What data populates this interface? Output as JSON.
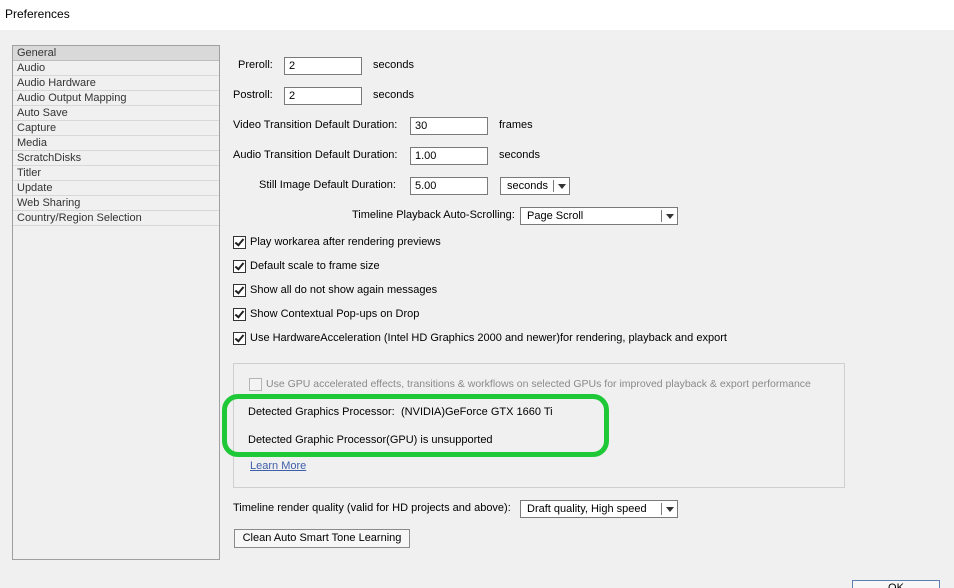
{
  "window": {
    "title": "Preferences"
  },
  "sidebar": {
    "items": [
      {
        "label": "General",
        "selected": true
      },
      {
        "label": "Audio"
      },
      {
        "label": "Audio Hardware"
      },
      {
        "label": "Audio Output Mapping"
      },
      {
        "label": "Auto Save"
      },
      {
        "label": "Capture"
      },
      {
        "label": "Media"
      },
      {
        "label": "ScratchDisks"
      },
      {
        "label": "Titler"
      },
      {
        "label": "Update"
      },
      {
        "label": "Web Sharing"
      },
      {
        "label": "Country/Region Selection"
      }
    ]
  },
  "general": {
    "preroll": {
      "label": "Preroll:",
      "value": "2",
      "unit": "seconds"
    },
    "postroll": {
      "label": "Postroll:",
      "value": "2",
      "unit": "seconds"
    },
    "video_transition": {
      "label": "Video Transition Default Duration:",
      "value": "30",
      "unit": "frames"
    },
    "audio_transition": {
      "label": "Audio Transition Default Duration:",
      "value": "1.00",
      "unit": "seconds"
    },
    "still_image": {
      "label": "Still Image Default Duration:",
      "value": "5.00",
      "unit": "seconds"
    },
    "timeline_scrolling": {
      "label": "Timeline Playback Auto-Scrolling:",
      "value": "Page Scroll"
    },
    "checkboxes": [
      {
        "label": "Play workarea after rendering previews",
        "checked": true
      },
      {
        "label": "Default scale to frame size",
        "checked": true
      },
      {
        "label": "Show all do not show again messages",
        "checked": true
      },
      {
        "label": "Show Contextual Pop-ups on Drop",
        "checked": true
      },
      {
        "label": "Use HardwareAcceleration (Intel HD Graphics 2000 and newer)for rendering, playback and export",
        "checked": true
      }
    ],
    "gpu": {
      "checkbox_label": "Use GPU accelerated effects, transitions & workflows on selected GPUs for improved playback & export performance",
      "checked": false,
      "detected_label": "Detected Graphics Processor:",
      "detected_value": "(NVIDIA)GeForce GTX 1660 Ti",
      "unsupported_text": "Detected Graphic Processor(GPU) is unsupported",
      "learn_more": "Learn More"
    },
    "render_quality": {
      "label": "Timeline render quality (valid for HD projects and above):",
      "value": "Draft quality, High speed"
    },
    "clean_button": "Clean Auto Smart Tone Learning"
  },
  "footer": {
    "ok_label": "OK"
  },
  "colors": {
    "highlight": "#1ec837",
    "link": "#3f5ea8"
  }
}
